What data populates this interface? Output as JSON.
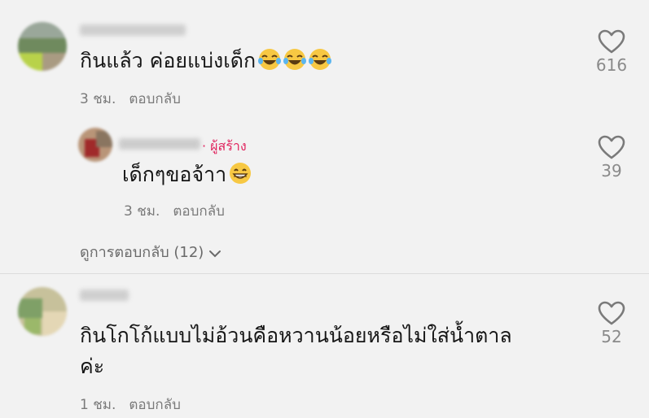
{
  "comments": [
    {
      "text": "กินแล้ว ค่อยแบ่งเด็ก",
      "emojis": [
        "laughing-tears",
        "laughing-tears",
        "laughing-tears"
      ],
      "time": "3 ชม.",
      "reply_label": "ตอบกลับ",
      "likes": "616"
    },
    {
      "text": "เด็กๆขอจ้าา",
      "emojis": [
        "grinning"
      ],
      "creator_label": "· ผู้สร้าง",
      "time": "3 ชม.",
      "reply_label": "ตอบกลับ",
      "likes": "39"
    },
    {
      "text_line1": "กินโกโก้แบบไม่อ้วนคือหวานน้อยหรือไม่ใส่น้ำตาล",
      "text_line2": "ค่ะ",
      "time": "1 ชม.",
      "reply_label": "ตอบกลับ",
      "likes": "52"
    }
  ],
  "view_replies": "ดูการตอบกลับ (12)",
  "colors": {
    "background": "#f2f2f2",
    "creator": "#e0245e",
    "meta": "#7a7a7a"
  }
}
